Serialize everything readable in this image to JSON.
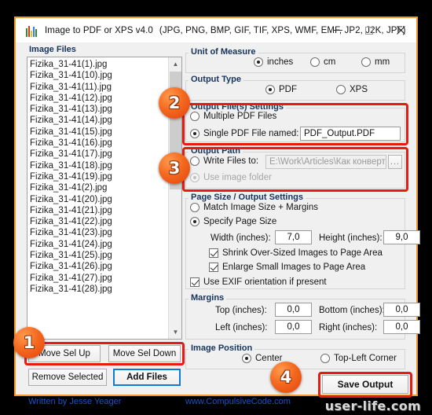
{
  "window": {
    "title": "Image to PDF or XPS  v4.0",
    "formats": "(JPG, PNG, BMP, GIF, TIF, XPS, WMF, EMF, JP2, J2K, JPF)",
    "icon": "bar-chart-icon",
    "controls": {
      "minimize": "minimize-icon",
      "maximize": "maximize-icon",
      "close": "close-icon"
    },
    "accent_border": "#f09a2c",
    "highlight_color": "#e81b12",
    "badge_color": "#f4691f"
  },
  "left_panel": {
    "group_label": "Image Files",
    "files": [
      "Fizika_31-41(1).jpg",
      "Fizika_31-41(10).jpg",
      "Fizika_31-41(11).jpg",
      "Fizika_31-41(12).jpg",
      "Fizika_31-41(13).jpg",
      "Fizika_31-41(14).jpg",
      "Fizika_31-41(15).jpg",
      "Fizika_31-41(16).jpg",
      "Fizika_31-41(17).jpg",
      "Fizika_31-41(18).jpg",
      "Fizika_31-41(19).jpg",
      "Fizika_31-41(2).jpg",
      "Fizika_31-41(20).jpg",
      "Fizika_31-41(21).jpg",
      "Fizika_31-41(22).jpg",
      "Fizika_31-41(23).jpg",
      "Fizika_31-41(24).jpg",
      "Fizika_31-41(25).jpg",
      "Fizika_31-41(26).jpg",
      "Fizika_31-41(27).jpg",
      "Fizika_31-41(28).jpg"
    ],
    "scroll_up_icon": "chevron-up-icon",
    "scroll_down_icon": "chevron-down-icon",
    "buttons": {
      "move_up": "Move Sel Up",
      "move_down": "Move Sel Down",
      "remove_selected": "Remove Selected",
      "add_files": "Add Files"
    }
  },
  "unit_of_measure": {
    "label": "Unit of Measure",
    "options": [
      "inches",
      "cm",
      "mm"
    ],
    "selected": "inches"
  },
  "output_type": {
    "label": "Output Type",
    "options": [
      "PDF",
      "XPS"
    ],
    "selected": "PDF"
  },
  "output_files_settings": {
    "label": "Output File(s) Settings",
    "multiple_label": "Multiple PDF Files",
    "single_label": "Single PDF File named:",
    "selected": "single",
    "filename": "PDF_Output.PDF"
  },
  "output_path": {
    "label": "Output Path",
    "write_files_label": "Write Files to:",
    "path_value": "E:\\Work\\Articles\\Как конвертирова",
    "browse_label": "...",
    "use_image_folder_label": "Use image folder",
    "selected": "use_image_folder"
  },
  "page_size": {
    "label": "Page Size / Output Settings",
    "match_label": "Match Image Size + Margins",
    "specify_label": "Specify Page Size",
    "selected": "specify",
    "width_label": "Width (inches):",
    "width_value": "7,0",
    "height_label": "Height (inches):",
    "height_value": "9,0",
    "shrink_label": "Shrink Over-Sized Images to Page Area",
    "shrink_checked": true,
    "enlarge_label": "Enlarge Small Images to Page Area",
    "enlarge_checked": true,
    "exif_label": "Use EXIF orientation if present",
    "exif_checked": true
  },
  "margins": {
    "label": "Margins",
    "top_label": "Top (inches):",
    "top_value": "0,0",
    "bottom_label": "Bottom (inches):",
    "bottom_value": "0,0",
    "left_label": "Left (inches):",
    "left_value": "0,0",
    "right_label": "Right (inches):",
    "right_value": "0,0"
  },
  "image_position": {
    "label": "Image Position",
    "options": [
      "Center",
      "Top-Left Corner"
    ],
    "selected": "Center"
  },
  "actions": {
    "save_output": "Save Output"
  },
  "footer": {
    "author": "Written by Jesse Yeager",
    "website": "www.CompulsiveCode.com"
  },
  "annotations": {
    "badges": [
      "1",
      "2",
      "3",
      "4"
    ]
  },
  "watermark": "user-life.com"
}
